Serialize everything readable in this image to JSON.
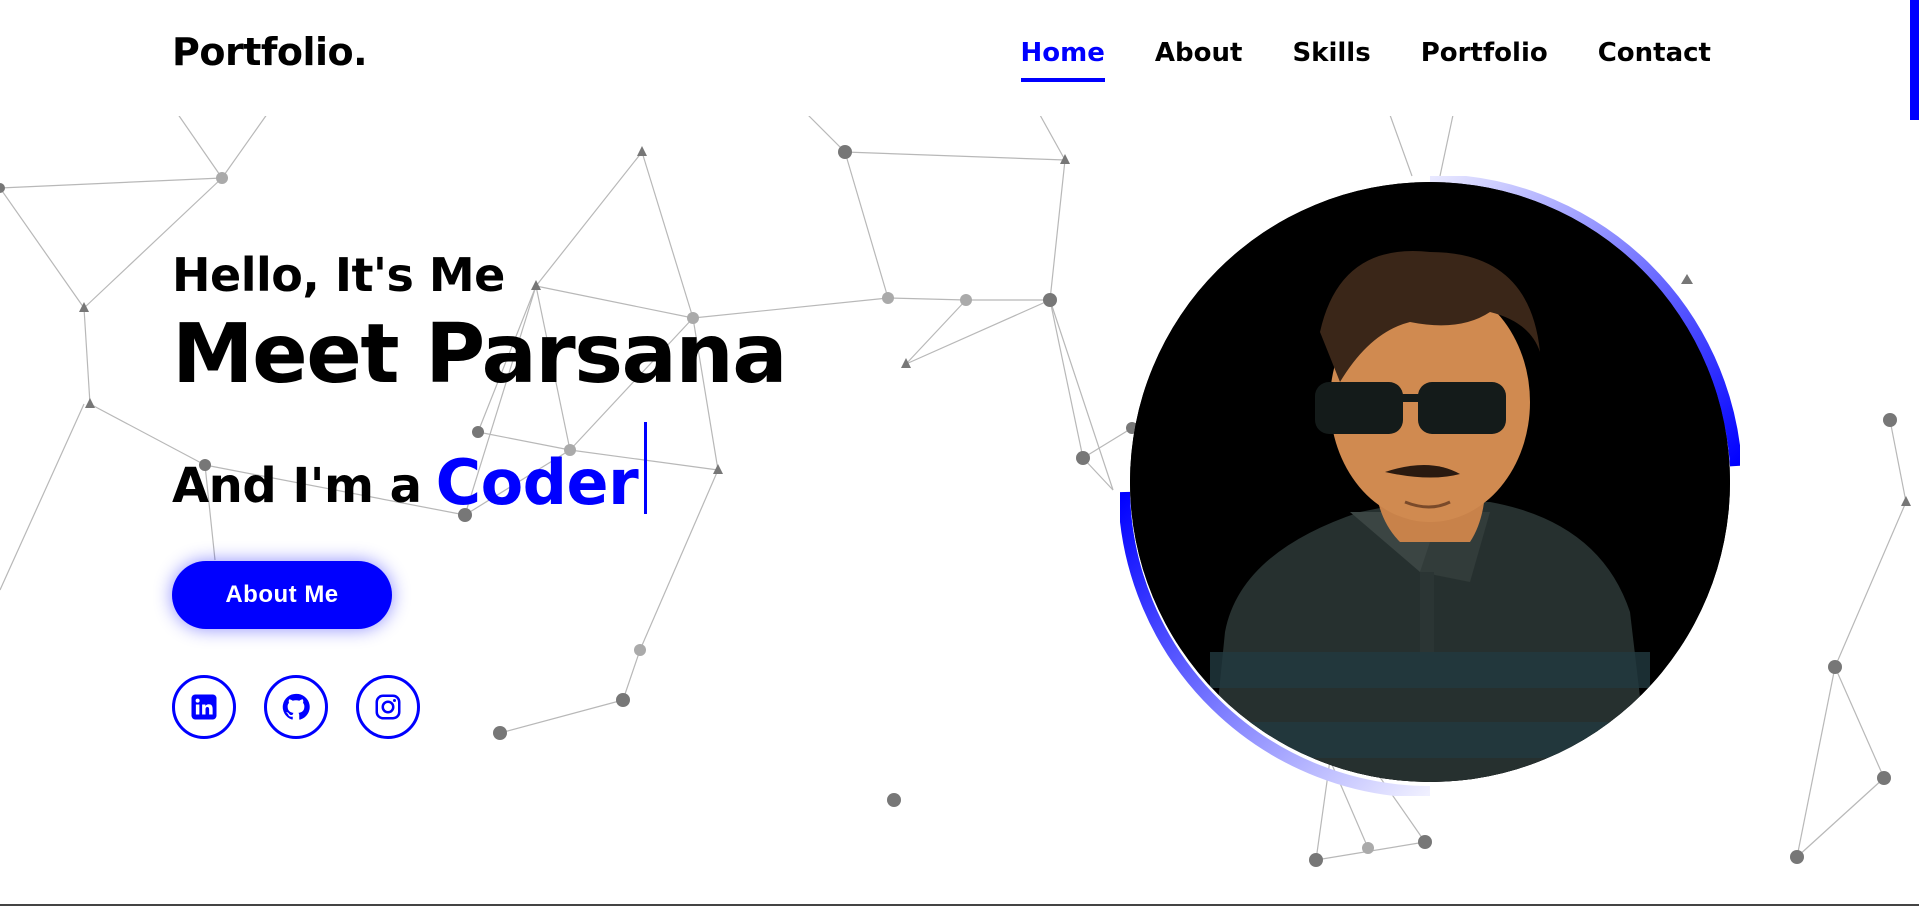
{
  "header": {
    "logo": "Portfolio.",
    "nav": [
      {
        "label": "Home",
        "active": true
      },
      {
        "label": "About",
        "active": false
      },
      {
        "label": "Skills",
        "active": false
      },
      {
        "label": "Portfolio",
        "active": false
      },
      {
        "label": "Contact",
        "active": false
      }
    ]
  },
  "hero": {
    "greeting": "Hello, It's Me",
    "name": "Meet Parsana",
    "role_prefix": "And I'm a",
    "role_word": "Coder",
    "cta_label": "About Me"
  },
  "socials": [
    {
      "name": "linkedin-icon"
    },
    {
      "name": "github-icon"
    },
    {
      "name": "instagram-icon"
    }
  ],
  "colors": {
    "accent": "#0000ff",
    "text": "#000000",
    "background": "#ffffff",
    "network": "#9a9a9a"
  },
  "portrait": {
    "icon": "avatar-illustration"
  }
}
